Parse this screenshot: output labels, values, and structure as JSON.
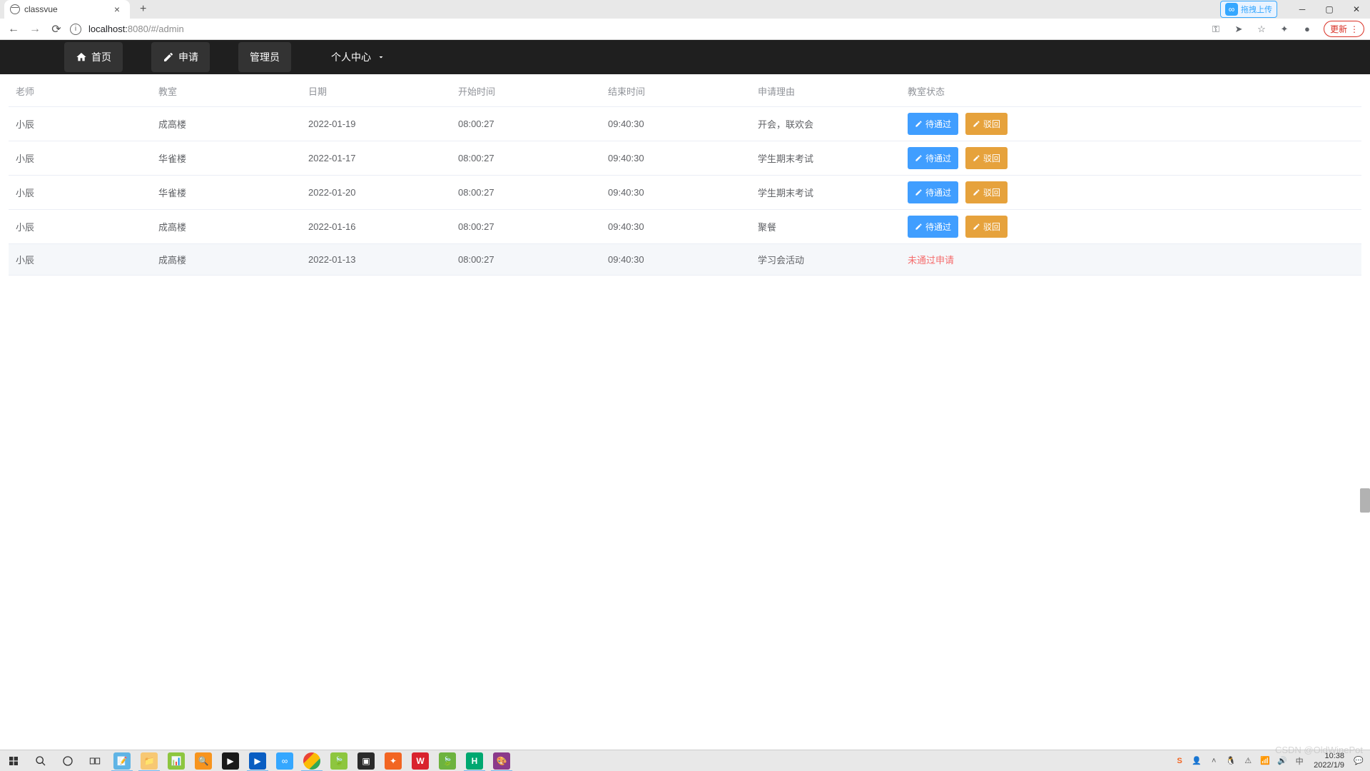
{
  "browser": {
    "tab_title": "classvue",
    "url_host": "localhost:",
    "url_port": "8080",
    "url_path": "/#/admin",
    "baidu_upload": "拖拽上传",
    "update_label": "更新"
  },
  "nav": {
    "home": "首页",
    "apply": "申请",
    "admin": "管理员",
    "personal": "个人中心"
  },
  "table": {
    "headers": {
      "teacher": "老师",
      "room": "教室",
      "date": "日期",
      "start": "开始时间",
      "end": "结束时间",
      "reason": "申请理由",
      "status": "教室状态"
    },
    "approve_label": "待通过",
    "reject_label": "驳回",
    "rejected_text": "未通过申请",
    "rows": [
      {
        "teacher": "小辰",
        "room": "成高楼",
        "date": "2022-01-19",
        "start": "08:00:27",
        "end": "09:40:30",
        "reason": "开会，联欢会",
        "status": "pending"
      },
      {
        "teacher": "小辰",
        "room": "华雀楼",
        "date": "2022-01-17",
        "start": "08:00:27",
        "end": "09:40:30",
        "reason": "学生期末考试",
        "status": "pending"
      },
      {
        "teacher": "小辰",
        "room": "华雀楼",
        "date": "2022-01-20",
        "start": "08:00:27",
        "end": "09:40:30",
        "reason": "学生期末考试",
        "status": "pending"
      },
      {
        "teacher": "小辰",
        "room": "成高楼",
        "date": "2022-01-16",
        "start": "08:00:27",
        "end": "09:40:30",
        "reason": "聚餐",
        "status": "pending"
      },
      {
        "teacher": "小辰",
        "room": "成高楼",
        "date": "2022-01-13",
        "start": "08:00:27",
        "end": "09:40:30",
        "reason": "学习会活动",
        "status": "rejected",
        "cursor": true
      }
    ]
  },
  "system": {
    "time": "10:38",
    "date": "2022/1/9",
    "watermark": "CSDN @OldWinePot"
  }
}
